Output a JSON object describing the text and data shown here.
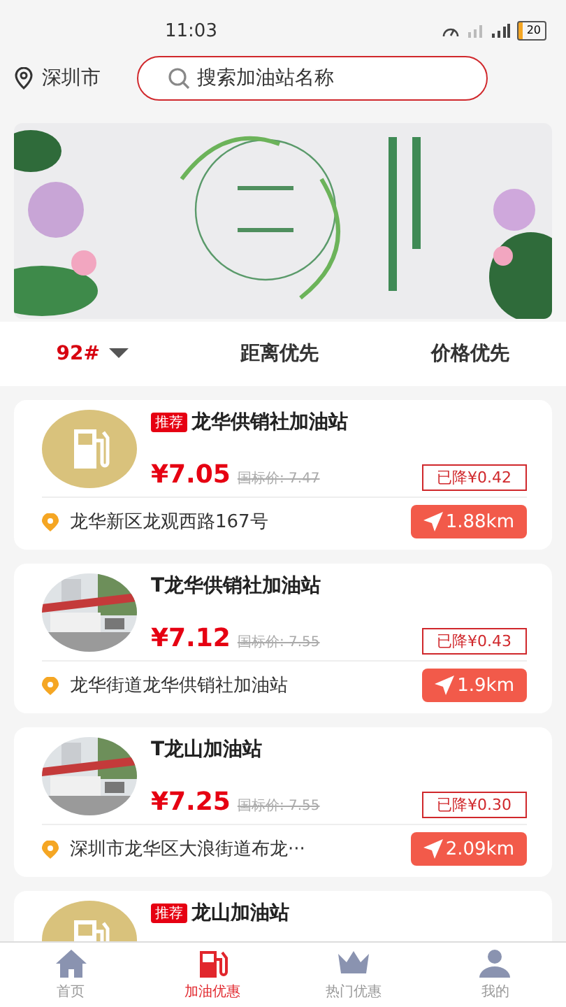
{
  "status_bar": {
    "time": "11:03",
    "battery": "20"
  },
  "header": {
    "city": "深圳市",
    "search": {
      "placeholder": "搜索加油站名称"
    }
  },
  "sort_bar": {
    "fuel_type": "92#",
    "options": [
      "距离优先",
      "价格优先"
    ]
  },
  "stations": [
    {
      "tag": "推荐",
      "name": "龙华供销社加油站",
      "kind": "logo",
      "price": "¥7.05",
      "list_price": "国标价: 7.47",
      "discount": "已降¥0.42",
      "address": "龙华新区龙观西路167号",
      "distance": "1.88km"
    },
    {
      "name": "T龙华供销社加油站",
      "kind": "picture",
      "price": "¥7.12",
      "list_price": "国标价: 7.55",
      "discount": "已降¥0.43",
      "address": "龙华街道龙华供销社加油站",
      "distance": "1.9km"
    },
    {
      "name": "T龙山加油站",
      "kind": "picture",
      "price": "¥7.25",
      "list_price": "国标价: 7.55",
      "discount": "已降¥0.30",
      "address": "深圳市龙华区大浪街道布龙···",
      "distance": "2.09km"
    },
    {
      "tag": "推荐",
      "name": "龙山加油站",
      "kind": "logo"
    }
  ],
  "tab_bar": [
    {
      "label": "首页",
      "selected": false
    },
    {
      "label": "加油优惠",
      "selected": true
    },
    {
      "label": "热门优惠",
      "selected": false
    },
    {
      "label": "我的",
      "selected": false
    }
  ]
}
